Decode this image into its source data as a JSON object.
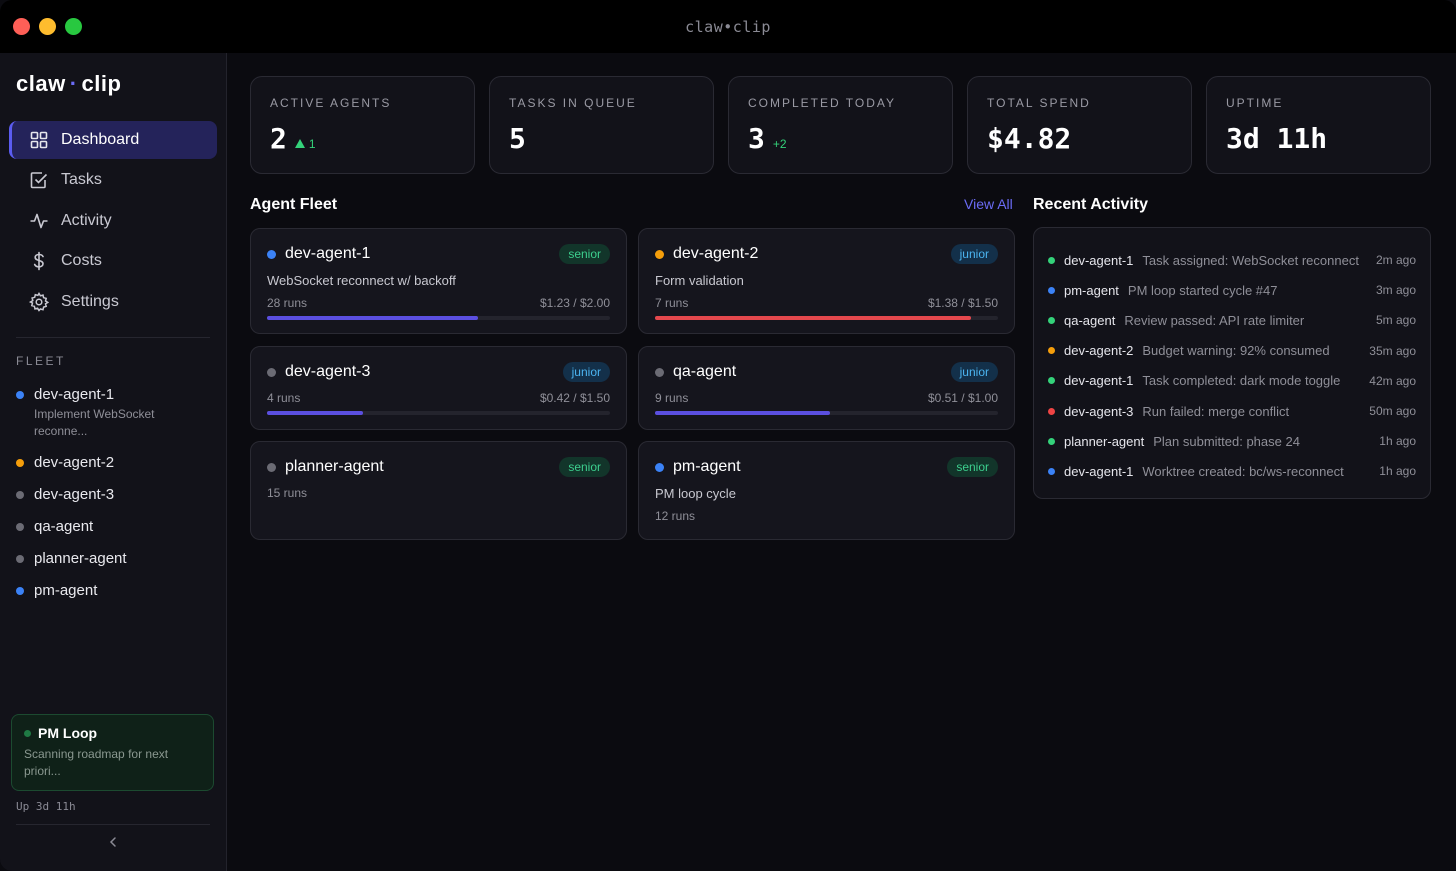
{
  "window": {
    "title": "claw•clip"
  },
  "colors": {
    "accent": "#6b6cf6",
    "green": "#34d27a",
    "blue": "#3b82f6",
    "amber": "#f59e0b",
    "gray": "#6b6b74",
    "red": "#ef4444"
  },
  "sidebar": {
    "brand_left": "claw",
    "brand_sep": "·",
    "brand_right": "clip",
    "nav": [
      {
        "label": "Dashboard",
        "icon": "dashboard-grid-icon"
      },
      {
        "label": "Tasks",
        "icon": "tasks-check-icon"
      },
      {
        "label": "Activity",
        "icon": "activity-pulse-icon"
      },
      {
        "label": "Costs",
        "icon": "dollar-icon"
      },
      {
        "label": "Settings",
        "icon": "gear-icon"
      }
    ],
    "fleet_title": "FLEET",
    "fleet": [
      {
        "name": "dev-agent-1",
        "status": "blue",
        "sub": "Implement WebSocket reconne..."
      },
      {
        "name": "dev-agent-2",
        "status": "amber",
        "sub": ""
      },
      {
        "name": "dev-agent-3",
        "status": "gray",
        "sub": ""
      },
      {
        "name": "qa-agent",
        "status": "gray",
        "sub": ""
      },
      {
        "name": "planner-agent",
        "status": "gray",
        "sub": ""
      },
      {
        "name": "pm-agent",
        "status": "blue",
        "sub": ""
      }
    ],
    "pm_loop": {
      "title": "PM Loop",
      "text": "Scanning roadmap for next priori..."
    },
    "uptime": "Up 3d 11h"
  },
  "stats": [
    {
      "label": "ACTIVE AGENTS",
      "value": "2",
      "delta": "1",
      "delta_arrow": true
    },
    {
      "label": "TASKS IN QUEUE",
      "value": "5",
      "delta": ""
    },
    {
      "label": "COMPLETED TODAY",
      "value": "3",
      "delta": "+2"
    },
    {
      "label": "TOTAL SPEND",
      "value": "$4.82",
      "delta": ""
    },
    {
      "label": "UPTIME",
      "value": "3d 11h",
      "delta": ""
    }
  ],
  "fleet_section": {
    "title": "Agent Fleet",
    "view_all": "View All",
    "agents": [
      {
        "name": "dev-agent-1",
        "status": "blue",
        "tier": "senior",
        "task": "WebSocket reconnect w/ backoff",
        "runs": "28 runs",
        "cost": "$1.23 / $2.00",
        "budget_used": 0.615,
        "bar_color": "#5b4fe0"
      },
      {
        "name": "dev-agent-2",
        "status": "amber",
        "tier": "junior",
        "task": "Form validation",
        "runs": "7 runs",
        "cost": "$1.38 / $1.50",
        "budget_used": 0.92,
        "bar_color": "#e5484d"
      },
      {
        "name": "dev-agent-3",
        "status": "gray",
        "tier": "junior",
        "task": "",
        "runs": "4 runs",
        "cost": "$0.42 / $1.50",
        "budget_used": 0.28,
        "bar_color": "#5b4fe0"
      },
      {
        "name": "qa-agent",
        "status": "gray",
        "tier": "junior",
        "task": "",
        "runs": "9 runs",
        "cost": "$0.51 / $1.00",
        "budget_used": 0.51,
        "bar_color": "#5b4fe0"
      },
      {
        "name": "planner-agent",
        "status": "gray",
        "tier": "senior",
        "task": "",
        "runs": "15 runs",
        "cost": "",
        "budget_used": null,
        "bar_color": ""
      },
      {
        "name": "pm-agent",
        "status": "blue",
        "tier": "senior",
        "task": "PM loop cycle",
        "runs": "12 runs",
        "cost": "",
        "budget_used": null,
        "bar_color": ""
      }
    ]
  },
  "activity_section": {
    "title": "Recent Activity",
    "items": [
      {
        "agent": "dev-agent-1",
        "message": "Task assigned: WebSocket reconnect",
        "time": "2m ago",
        "status": "green"
      },
      {
        "agent": "pm-agent",
        "message": "PM loop started cycle #47",
        "time": "3m ago",
        "status": "blue"
      },
      {
        "agent": "qa-agent",
        "message": "Review passed: API rate limiter",
        "time": "5m ago",
        "status": "green"
      },
      {
        "agent": "dev-agent-2",
        "message": "Budget warning: 92% consumed",
        "time": "35m ago",
        "status": "amber"
      },
      {
        "agent": "dev-agent-1",
        "message": "Task completed: dark mode toggle",
        "time": "42m ago",
        "status": "green"
      },
      {
        "agent": "dev-agent-3",
        "message": "Run failed: merge conflict",
        "time": "50m ago",
        "status": "red"
      },
      {
        "agent": "planner-agent",
        "message": "Plan submitted: phase 24",
        "time": "1h ago",
        "status": "green"
      },
      {
        "agent": "dev-agent-1",
        "message": "Worktree created: bc/ws-reconnect",
        "time": "1h ago",
        "status": "blue"
      }
    ]
  }
}
